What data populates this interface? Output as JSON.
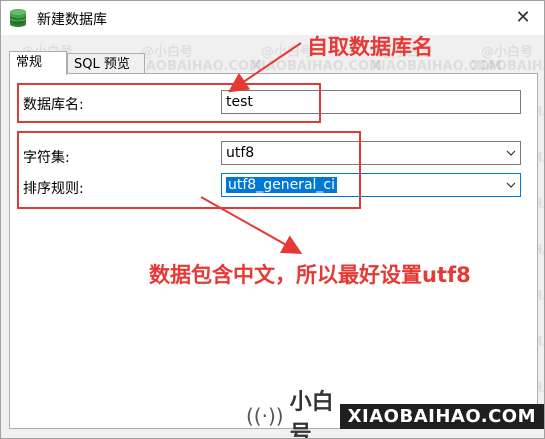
{
  "window": {
    "title": "新建数据库",
    "close_glyph": "✕",
    "icon": "database-icon"
  },
  "tabs": [
    {
      "label": "常规",
      "active": true
    },
    {
      "label": "SQL 预览",
      "active": false
    }
  ],
  "form": {
    "db_name_label": "数据库名:",
    "db_name_value": "test",
    "charset_label": "字符集:",
    "charset_value": "utf8",
    "collation_label": "排序规则:",
    "collation_value": "utf8_general_ci"
  },
  "annotations": {
    "name_note": "自取数据库名",
    "charset_note": "数据包含中文，所以最好设置utf8",
    "color": "#e53935"
  },
  "watermark": {
    "cn": "@小白号",
    "en": "XIAOBAIHAO.COM",
    "footer_cn": "小白号",
    "footer_en": "XIAOBAIHAO.COM",
    "footer_icon": "((·))"
  }
}
